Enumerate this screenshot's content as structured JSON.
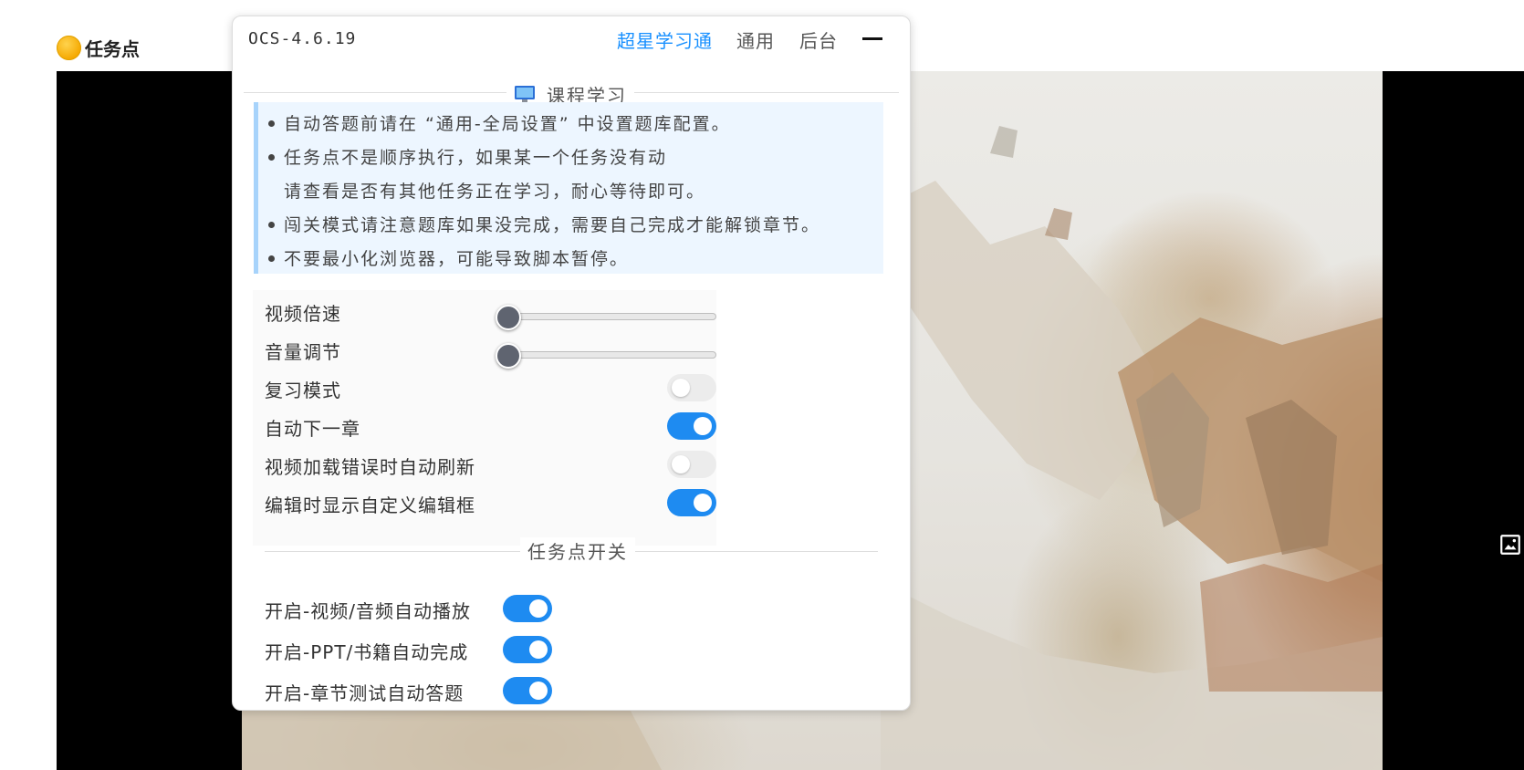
{
  "page": {
    "task_label": "任务点",
    "colors": {
      "accent": "#1890ff",
      "toggle_on": "#1e8bf1",
      "notice_bg": "#edf6ff"
    }
  },
  "panel": {
    "version": "OCS-4.6.19",
    "tabs": [
      {
        "label": "超星学习通",
        "active": true
      },
      {
        "label": "通用",
        "active": false
      },
      {
        "label": "后台",
        "active": false
      }
    ],
    "section_title": "课程学习",
    "section_icon": "computer-monitor-icon",
    "notices": [
      "自动答题前请在 “通用-全局设置” 中设置题库配置。",
      "任务点不是顺序执行，如果某一个任务没有动",
      "请查看是否有其他任务正在学习，耐心等待即可。",
      "闯关模式请注意题库如果没完成，需要自己完成才能解锁章节。",
      "不要最小化浏览器，可能导致脚本暂停。"
    ],
    "settings": {
      "playback_speed_label": "视频倍速",
      "playback_speed_value": 0,
      "volume_label": "音量调节",
      "volume_value": 0,
      "review_mode_label": "复习模式",
      "review_mode_on": false,
      "auto_next_label": "自动下一章",
      "auto_next_on": true,
      "auto_refresh_label": "视频加载错误时自动刷新",
      "auto_refresh_on": false,
      "custom_editor_label": "编辑时显示自定义编辑框",
      "custom_editor_on": true
    },
    "task_switch_title": "任务点开关",
    "task_switches": {
      "video_label": "开启-视频/音频自动播放",
      "video_on": true,
      "ppt_label": "开启-PPT/书籍自动完成",
      "ppt_on": true,
      "quiz_label": "开启-章节测试自动答题",
      "quiz_on": true
    }
  }
}
